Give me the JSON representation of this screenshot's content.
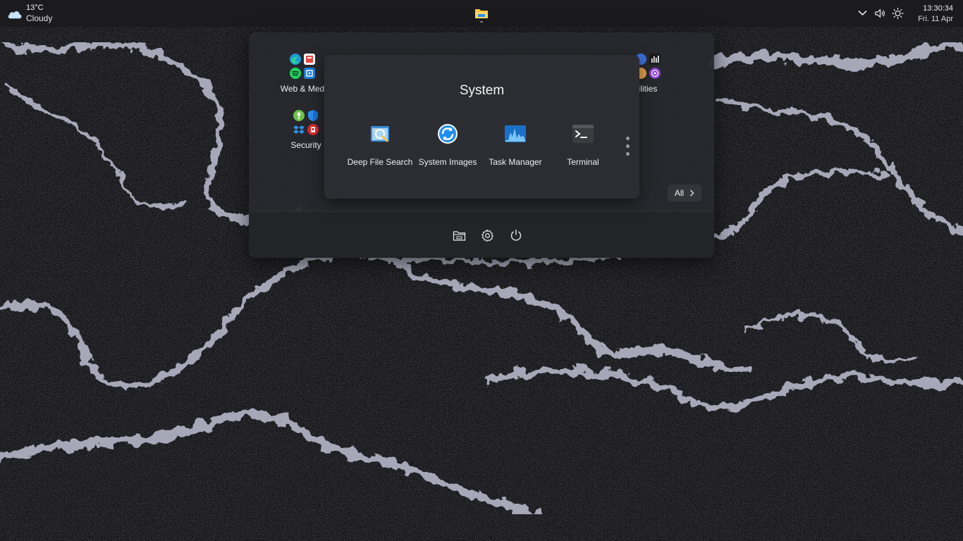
{
  "weather": {
    "temperature": "13°C",
    "condition": "Cloudy",
    "icon": "cloud-icon"
  },
  "taskbar": {
    "pinned_app_icon": "file-explorer-icon"
  },
  "tray": {
    "icons": [
      "chevron-down-icon",
      "volume-icon",
      "brightness-icon"
    ],
    "time": "13:30:34",
    "date": "Fri. 11 Apr"
  },
  "start": {
    "groups": [
      {
        "label": "Web & Med"
      },
      {
        "label": "Security"
      },
      {
        "label": "ilities"
      }
    ],
    "all_button": {
      "label": "All"
    },
    "footer": [
      "file-manager-icon",
      "settings-icon",
      "power-icon"
    ]
  },
  "folder": {
    "title": "System",
    "apps": [
      {
        "name": "Deep File Search",
        "icon": "deep-file-search-icon"
      },
      {
        "name": "System Images",
        "icon": "system-images-icon"
      },
      {
        "name": "Task Manager",
        "icon": "task-manager-icon"
      },
      {
        "name": "Terminal",
        "icon": "terminal-icon"
      }
    ],
    "page_indicator": "more-dots"
  },
  "colors": {
    "topbar": "#1b1b1e",
    "panel": "#28292e",
    "accent_blue": "#1f8ef1",
    "wave_foam": "#dcdcf2"
  }
}
